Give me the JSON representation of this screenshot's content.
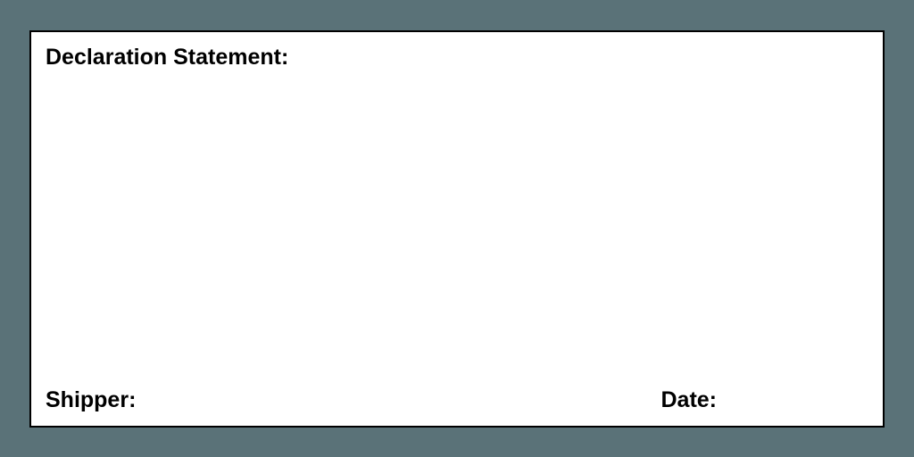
{
  "form": {
    "declaration_label": "Declaration Statement:",
    "shipper_label": "Shipper:",
    "date_label": "Date:"
  }
}
